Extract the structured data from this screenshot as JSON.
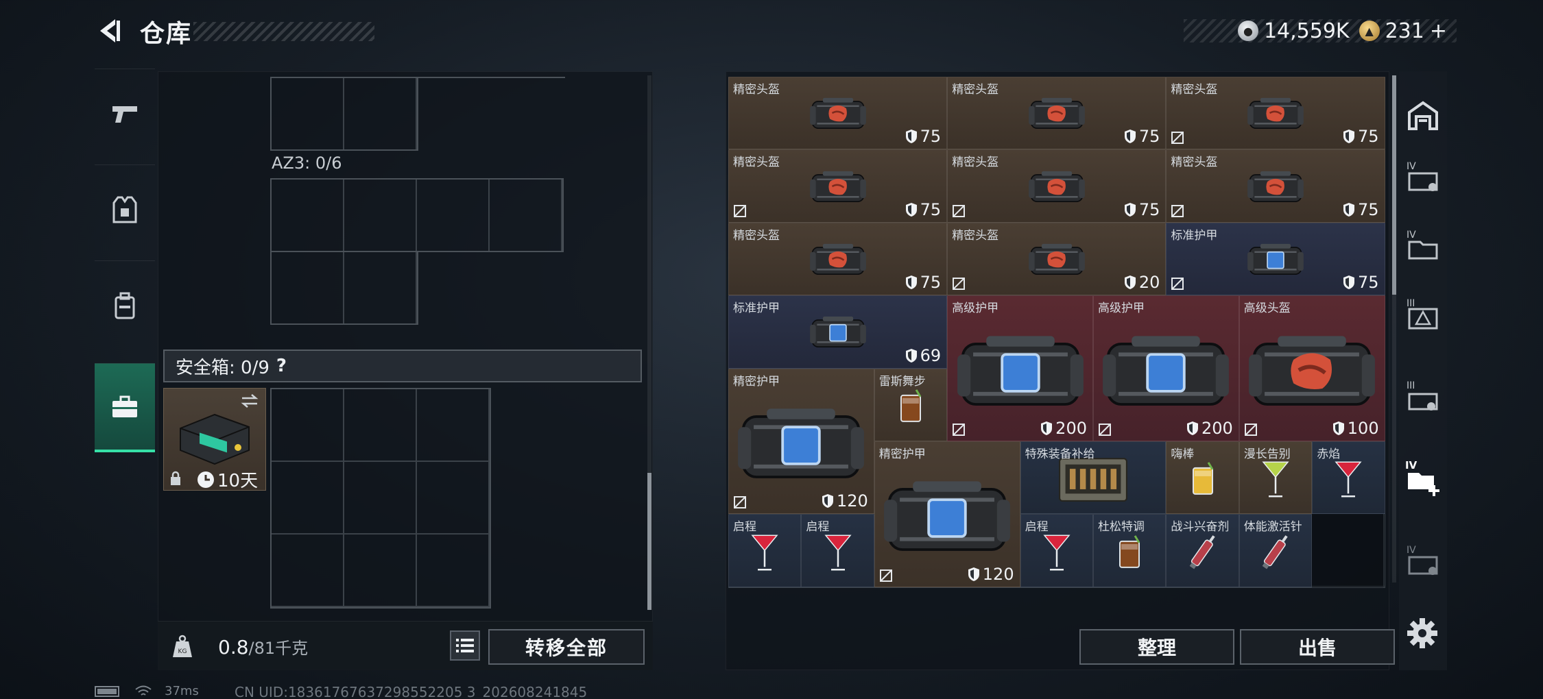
{
  "header": {
    "title": "仓库"
  },
  "currency": {
    "silver": "14,559K",
    "gold": "231",
    "gold_plus": "+"
  },
  "left_tabs": [
    {
      "icon": "pistol-icon"
    },
    {
      "icon": "vest-icon"
    },
    {
      "icon": "backpack-icon"
    },
    {
      "icon": "briefcase-icon",
      "active": true
    }
  ],
  "left": {
    "az3_label": "AZ3: 0/6",
    "safe_label": "安全箱: 0/9",
    "safe_help": "?",
    "safe_item_timer": "10天",
    "weight_value": "0.8",
    "weight_capacity": "/81千克",
    "transfer_all": "转移全部"
  },
  "inventory": [
    {
      "name": "精密头盔",
      "dur": "75",
      "linked": true,
      "type": "helm",
      "bg": "helm"
    },
    {
      "name": "精密头盔",
      "dur": "75",
      "linked": true,
      "type": "helm",
      "bg": "helm"
    },
    {
      "name": "精密头盔",
      "dur": "75",
      "linked": false,
      "type": "helm",
      "bg": "helm"
    },
    {
      "name": "精密头盔",
      "dur": "75",
      "linked": false,
      "type": "helm",
      "bg": "helm"
    },
    {
      "name": "精密头盔",
      "dur": "75",
      "linked": false,
      "type": "helm",
      "bg": "helm"
    },
    {
      "name": "精密头盔",
      "dur": "75",
      "linked": false,
      "type": "helm",
      "bg": "helm"
    },
    {
      "name": "精密头盔",
      "dur": "75",
      "linked": true,
      "type": "helm",
      "bg": "helm"
    },
    {
      "name": "精密头盔",
      "dur": "20",
      "linked": false,
      "type": "helm",
      "bg": "helm"
    },
    {
      "name": "标准护甲",
      "dur": "75",
      "linked": false,
      "type": "armor",
      "bg": "std"
    },
    {
      "name": "标准护甲",
      "dur": "69",
      "linked": true,
      "type": "armor",
      "bg": "std"
    },
    {
      "name": "高级护甲",
      "dur": "200",
      "linked": false,
      "type": "armor-big",
      "bg": "red"
    },
    {
      "name": "高级护甲",
      "dur": "200",
      "linked": false,
      "type": "armor-big",
      "bg": "red"
    },
    {
      "name": "高级头盔",
      "dur": "100",
      "linked": false,
      "type": "helm-big",
      "bg": "red"
    },
    {
      "name": "精密护甲",
      "dur": "120",
      "linked": false,
      "type": "armor-big",
      "bg": "helm"
    },
    {
      "name": "雷斯舞步",
      "type": "cocktail-brown",
      "bg": "helm"
    },
    {
      "name": "精密护甲",
      "dur": "120",
      "linked": false,
      "type": "armor-big",
      "bg": "helm"
    },
    {
      "name": "特殊装备补给",
      "type": "crate",
      "bg": "blue"
    },
    {
      "name": "嗨棒",
      "type": "cocktail-yellow",
      "bg": "gold"
    },
    {
      "name": "漫长告别",
      "type": "cocktail-green",
      "bg": "gold"
    },
    {
      "name": "赤焰",
      "type": "cocktail-red",
      "bg": "blue"
    },
    {
      "name": "启程",
      "type": "cocktail-red",
      "bg": "blue"
    },
    {
      "name": "启程",
      "type": "cocktail-red",
      "bg": "blue"
    },
    {
      "name": "启程",
      "type": "cocktail-red",
      "bg": "blue"
    },
    {
      "name": "杜松特调",
      "type": "cocktail-brown",
      "bg": "blue"
    },
    {
      "name": "战斗兴奋剂",
      "type": "syringe",
      "bg": "blue"
    },
    {
      "name": "体能激活针",
      "type": "syringe",
      "bg": "blue"
    }
  ],
  "actions": {
    "sort": "整理",
    "sell": "出售"
  },
  "right_rail_labels": [
    "",
    "IV",
    "IV",
    "III",
    "III",
    "IV",
    "IV"
  ],
  "status": {
    "ping": "37ms",
    "uid": "CN UID:18361767637298552205 3_202608241845"
  },
  "colors": {
    "accent": "#36e0a7",
    "helm_bg": "#4a3e33",
    "armor_bg": "#2c3349",
    "rare_bg": "#5a2a31"
  }
}
